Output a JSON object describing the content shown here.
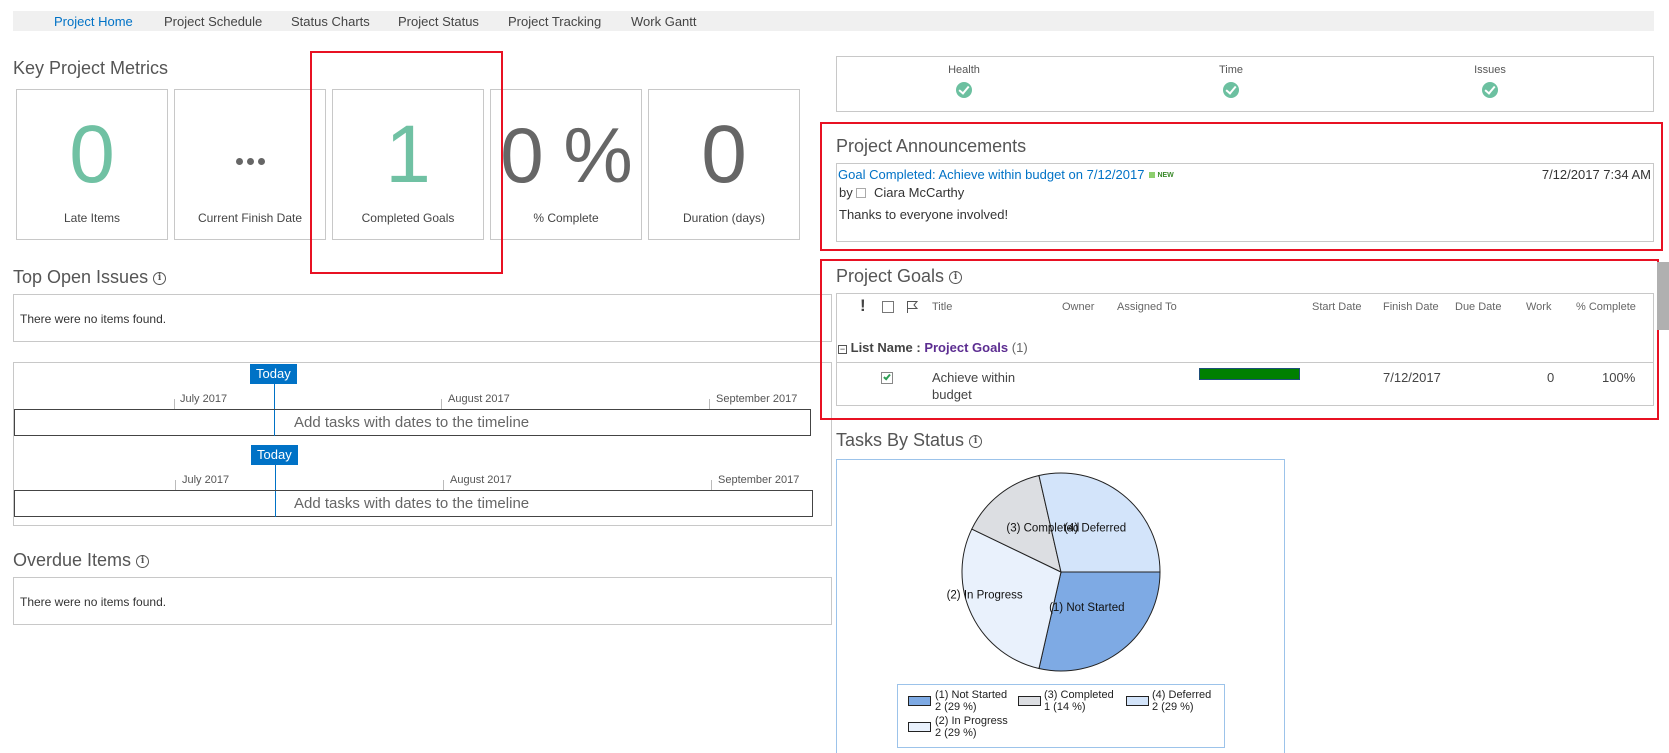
{
  "nav": {
    "items": [
      {
        "label": "Project Home",
        "active": true
      },
      {
        "label": "Project Schedule",
        "active": false
      },
      {
        "label": "Status Charts",
        "active": false
      },
      {
        "label": "Project Status",
        "active": false
      },
      {
        "label": "Project Tracking",
        "active": false
      },
      {
        "label": "Work Gantt",
        "active": false
      }
    ]
  },
  "metrics": {
    "title": "Key Project Metrics",
    "tiles": [
      {
        "value": "0",
        "label": "Late Items"
      },
      {
        "value": "...",
        "label": "Current Finish Date"
      },
      {
        "value": "1",
        "label": "Completed Goals"
      },
      {
        "value": "0 %",
        "label": "% Complete"
      },
      {
        "value": "0",
        "label": "Duration (days)"
      }
    ]
  },
  "status": {
    "items": [
      {
        "label": "Health",
        "state": "ok",
        "icon": "check-circle-icon"
      },
      {
        "label": "Time",
        "state": "ok",
        "icon": "check-circle-icon"
      },
      {
        "label": "Issues",
        "state": "ok",
        "icon": "check-circle-icon"
      }
    ],
    "ok_color": "#6cc0a0"
  },
  "issues": {
    "title": "Top Open Issues",
    "empty_text": "There were no items found."
  },
  "timeline": {
    "today_label": "Today",
    "months": [
      "July 2017",
      "August 2017",
      "September 2017"
    ],
    "placeholder": "Add tasks with dates to the timeline"
  },
  "overdue": {
    "title": "Overdue Items",
    "empty_text": "There were no items found."
  },
  "announcements": {
    "title": "Project Announcements",
    "items": [
      {
        "title": "Goal Completed: Achieve within budget on 7/12/2017",
        "badge": "NEW",
        "by_prefix": "by",
        "author": "Ciara McCarthy",
        "body": "Thanks to everyone involved!",
        "timestamp": "7/12/2017 7:34 AM"
      }
    ]
  },
  "goals": {
    "title": "Project Goals",
    "columns": [
      "!",
      "",
      "",
      "Title",
      "Owner",
      "Assigned To",
      "",
      "Start Date",
      "Finish Date",
      "Due Date",
      "Work",
      "% Complete"
    ],
    "group": {
      "prefix": "List Name :",
      "name": "Project Goals",
      "count": "(1)"
    },
    "rows": [
      {
        "checked": true,
        "title": "Achieve within budget",
        "title_line1": "Achieve within",
        "title_line2": "budget",
        "owner": "",
        "assigned_to": "",
        "progress": 1.0,
        "start_date": "",
        "finish_date": "7/12/2017",
        "due_date": "",
        "work": "0",
        "percent_complete": "100%"
      }
    ]
  },
  "tasks_chart": {
    "title": "Tasks By Status"
  },
  "chart_data": {
    "type": "pie",
    "title": "Tasks By Status",
    "slices": [
      {
        "label": "(1) Not Started",
        "value": 2,
        "percent": 29,
        "legend_value": "2 (29 %)",
        "color": "#7eaae4"
      },
      {
        "label": "(2) In Progress",
        "value": 2,
        "percent": 29,
        "legend_value": "2 (29 %)",
        "color": "#e9f1fc"
      },
      {
        "label": "(3) Completed",
        "value": 1,
        "percent": 14,
        "legend_value": "1 (14 %)",
        "color": "#dcdee2"
      },
      {
        "label": "(4) Deferred",
        "value": 2,
        "percent": 29,
        "legend_value": "2 (29 %)",
        "color": "#d3e4fa"
      }
    ],
    "legend_order": [
      0,
      2,
      3,
      1
    ],
    "legend_placement": "bottom"
  },
  "colors": {
    "accent": "#0072c6",
    "metric_green": "#70c1a3",
    "highlight_frame": "#e81123",
    "progress_fill": "#008000",
    "group_name": "#5c2d91"
  }
}
